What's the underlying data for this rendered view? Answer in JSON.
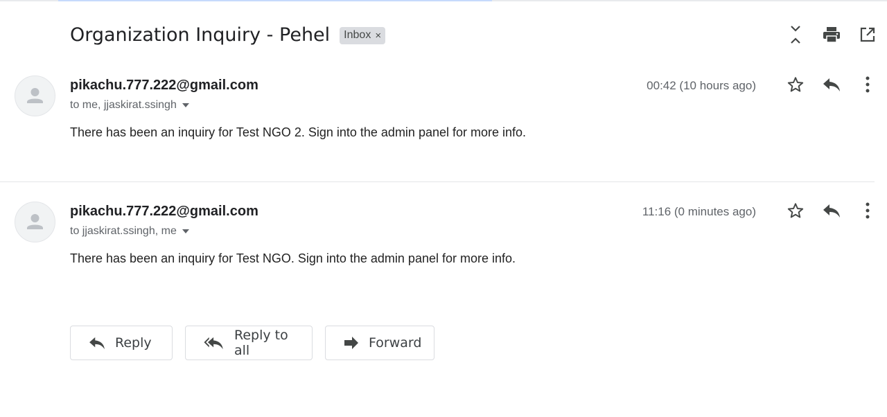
{
  "subject": "Organization Inquiry - Pehel",
  "label_chip": {
    "text": "Inbox",
    "remove": "×"
  },
  "top_actions": [
    "collapse-all-icon",
    "print-icon",
    "open-in-new-window-icon"
  ],
  "messages": [
    {
      "sender": "pikachu.777.222@gmail.com",
      "recipients": "to me, jjaskirat.ssingh",
      "time": "00:42 (10 hours ago)",
      "body": "There has been an inquiry for Test NGO 2. Sign into the admin panel for more info."
    },
    {
      "sender": "pikachu.777.222@gmail.com",
      "recipients": "to jjaskirat.ssingh, me",
      "time": "11:16 (0 minutes ago)",
      "body": "There has been an inquiry for Test NGO. Sign into the admin panel for more info."
    }
  ],
  "bottom_actions": {
    "reply": "Reply",
    "reply_all": "Reply to all",
    "forward": "Forward"
  },
  "colors": {
    "icon": "#5f6368",
    "text": "#202124",
    "secondary": "#5f6368",
    "chip_bg": "#dadce0"
  }
}
